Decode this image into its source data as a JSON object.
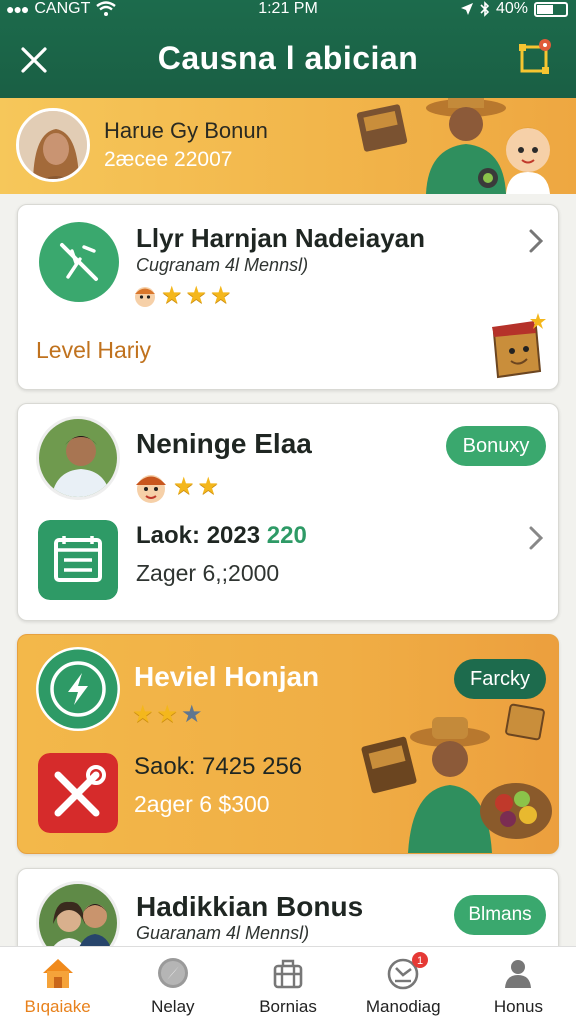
{
  "status_bar": {
    "carrier": "CANGT",
    "time": "1:21 PM",
    "battery": "40%"
  },
  "header": {
    "title": "Causna l abician",
    "close_icon": "close-icon",
    "action_icon": "frame-icon",
    "accent": "#1b6448"
  },
  "banner": {
    "title": "Harue Gy Bonun",
    "subtitle": "2æcee 22007"
  },
  "cards": [
    {
      "title": "Llyr Harnjan Nadeiayan",
      "subtitle": "Cugranam 4l Mennsl)",
      "stars": [
        1,
        1,
        1
      ],
      "footer": "Level Hariy",
      "icon": "no-signal-icon"
    },
    {
      "title": "Neninge Elaa",
      "badge": "Bonuxy",
      "stars": [
        1,
        1
      ],
      "stat_label": "Laok:",
      "stat_value_a": "2023",
      "stat_value_b": "220",
      "stat_sub": "Zager 6,;2000",
      "icon": "calendar-icon"
    },
    {
      "title": "Heviel Honjan",
      "badge": "Farcky",
      "stars": [
        1,
        1,
        0
      ],
      "stat_label": "Saok:",
      "stat_value": "7425 256",
      "stat_sub": "2ager 6 $300",
      "icon": "lightning-icon",
      "tool_icon": "tools-icon"
    },
    {
      "title": "Hadikkian Bonus",
      "subtitle": "Guaranam 4l Mennsl)",
      "badge": "Blmans"
    }
  ],
  "nav": [
    {
      "label": "Bıqaiake",
      "icon": "home-icon",
      "active": true
    },
    {
      "label": "Nelay",
      "icon": "compass-icon",
      "active": false
    },
    {
      "label": "Bornias",
      "icon": "briefcase-icon",
      "active": false
    },
    {
      "label": "Manodiag",
      "icon": "gauge-icon",
      "active": false,
      "notification": "1"
    },
    {
      "label": "Honus",
      "icon": "profile-icon",
      "active": false
    }
  ],
  "colors": {
    "green": "#3aa86e",
    "dark_green": "#1d6b4d",
    "orange": "#f2b64b",
    "star": "#f4b71c",
    "active_nav": "#e8811b"
  }
}
